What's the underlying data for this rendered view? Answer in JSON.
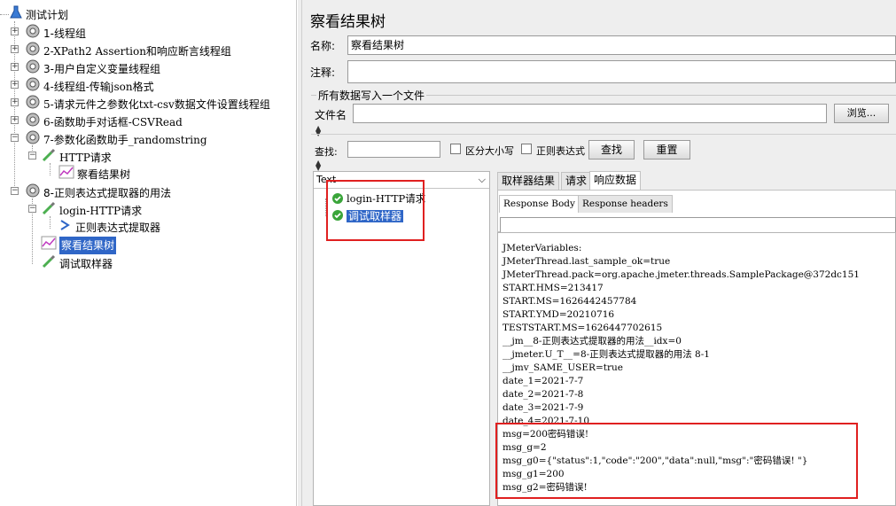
{
  "tree": {
    "root": "测试计划",
    "items": [
      "1-线程组",
      "2-XPath2 Assertion和响应断言线程组",
      "3-用户自定义变量线程组",
      "4-线程组-传输json格式",
      "5-请求元件之参数化txt-csv数据文件设置线程组",
      "6-函数助手对话框-CSVRead",
      "7-参数化函数助手_randomstring",
      "HTTP请求",
      "察看结果树",
      "8-正则表达式提取器的用法",
      "login-HTTP请求",
      "正则表达式提取器",
      "察看结果树",
      "调试取样器"
    ]
  },
  "panel": {
    "title": "察看结果树",
    "name_label": "名称:",
    "name_value": "察看结果树",
    "comment_label": "注释:",
    "comment_value": "",
    "write_all_label": "所有数据写入一个文件",
    "filename_label": "文件名",
    "filename_value": "",
    "browse_button": "浏览..."
  },
  "search": {
    "label": "查找:",
    "value": "",
    "case_label": "区分大小写",
    "regex_label": "正则表达式",
    "find_button": "查找",
    "reset_button": "重置"
  },
  "results": {
    "header": "Text",
    "items": [
      "login-HTTP请求",
      "调试取样器"
    ]
  },
  "tabs": [
    "取样器结果",
    "请求",
    "响应数据"
  ],
  "subtabs": [
    "Response Body",
    "Response headers"
  ],
  "response_lines": [
    "JMeterVariables:",
    "JMeterThread.last_sample_ok=true",
    "JMeterThread.pack=org.apache.jmeter.threads.SamplePackage@372dc151",
    "START.HMS=213417",
    "START.MS=1626442457784",
    "START.YMD=20210716",
    "TESTSTART.MS=1626447702615",
    "__jm__8-正则表达式提取器的用法__idx=0",
    "__jmeter.U_T__=8-正则表达式提取器的用法 8-1",
    "__jmv_SAME_USER=true",
    "date_1=2021-7-7",
    "date_2=2021-7-8",
    "date_3=2021-7-9",
    "date_4=2021-7-10",
    "msg=200密码错误!",
    "msg_g=2",
    "msg_g0={\"status\":1,\"code\":\"200\",\"data\":null,\"msg\":\"密码错误! \"}",
    "msg_g1=200",
    "msg_g2=密码错误!"
  ],
  "colors": {
    "selection": "#2f66c7",
    "annotation_box": "#e02020"
  }
}
